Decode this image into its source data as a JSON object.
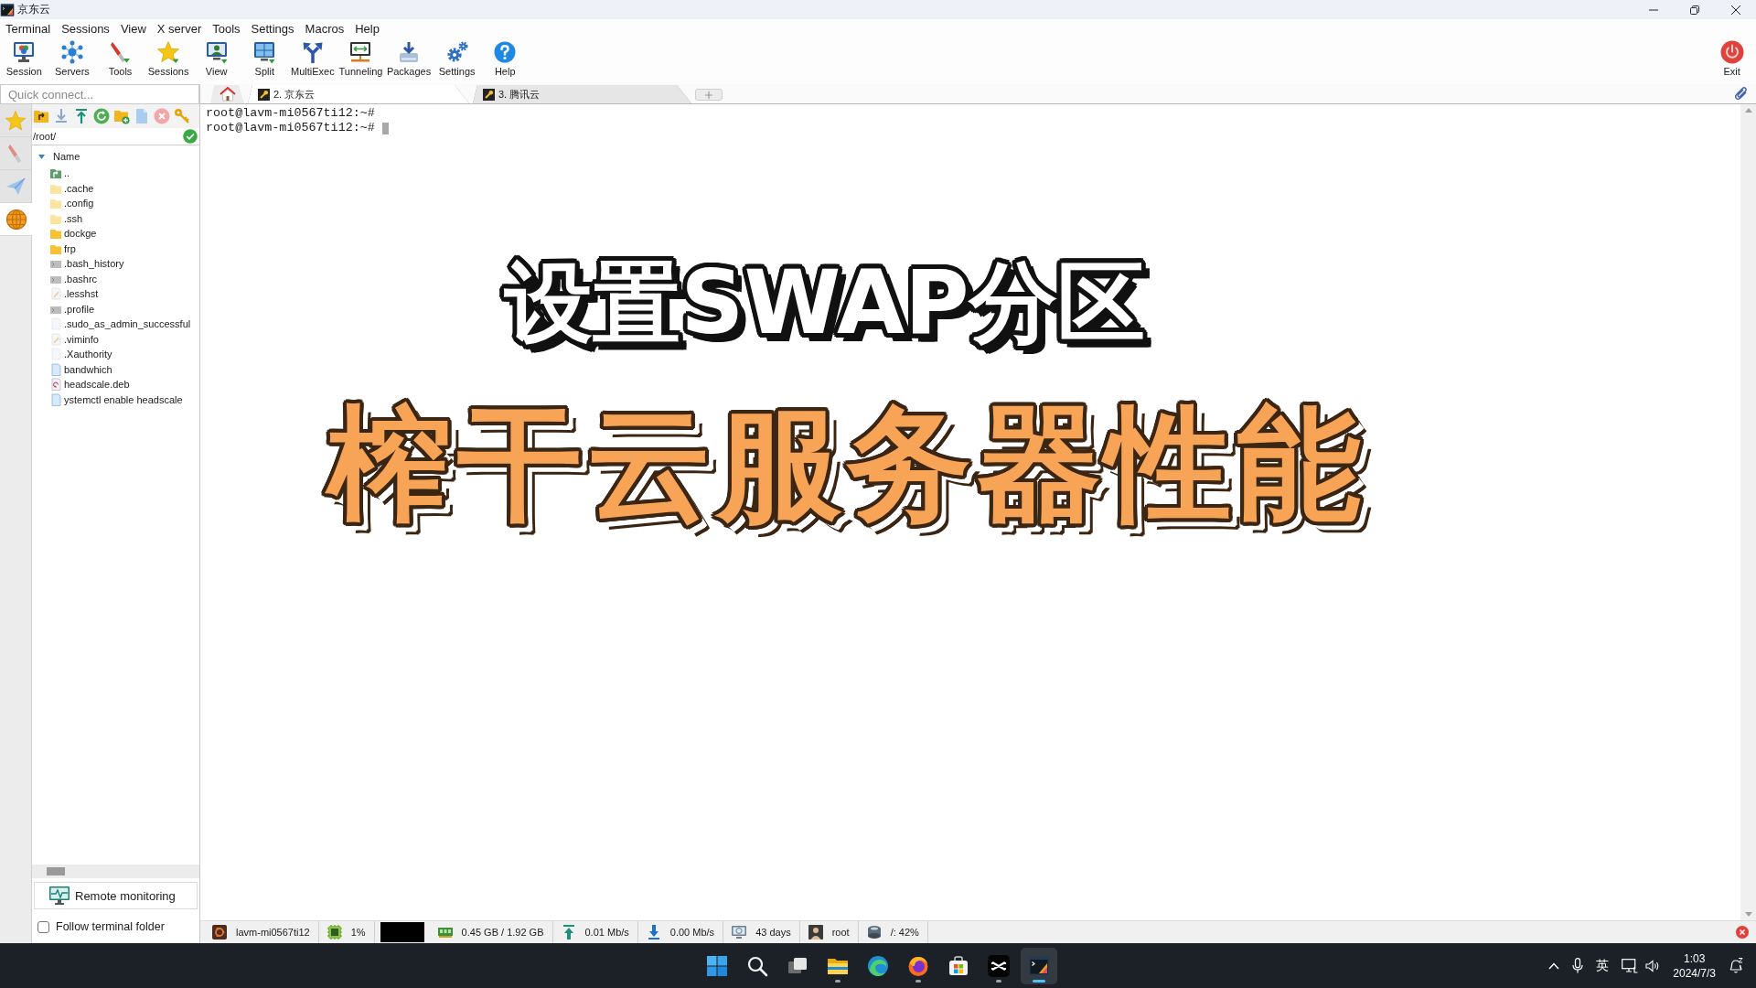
{
  "window": {
    "title": "京东云"
  },
  "menu": [
    "Terminal",
    "Sessions",
    "View",
    "X server",
    "Tools",
    "Settings",
    "Macros",
    "Help"
  ],
  "toolbar": [
    {
      "kind": "session",
      "label": "Session"
    },
    {
      "kind": "servers",
      "label": "Servers"
    },
    {
      "kind": "tools",
      "label": "Tools"
    },
    {
      "kind": "sessions",
      "label": "Sessions"
    },
    {
      "kind": "view",
      "label": "View"
    },
    {
      "kind": "split",
      "label": "Split"
    },
    {
      "kind": "multiexec",
      "label": "MultiExec"
    },
    {
      "kind": "tunneling",
      "label": "Tunneling"
    },
    {
      "kind": "packages",
      "label": "Packages"
    },
    {
      "kind": "settings",
      "label": "Settings"
    },
    {
      "kind": "help",
      "label": "Help"
    }
  ],
  "exit_button": {
    "label": "Exit"
  },
  "quick_connect": {
    "placeholder": "Quick connect..."
  },
  "tabs": [
    {
      "label": "2. 京东云",
      "selected": true
    },
    {
      "label": "3. 腾讯云",
      "selected": false
    }
  ],
  "side_tabs": [
    {
      "kind": "sessions",
      "selected": false
    },
    {
      "kind": "tools",
      "selected": false
    },
    {
      "kind": "macros",
      "selected": false
    },
    {
      "kind": "sftp",
      "selected": true
    }
  ],
  "file_browser": {
    "path": "/root/",
    "columns": [
      "Name"
    ],
    "files": [
      {
        "name": "..",
        "kind": "parent"
      },
      {
        "name": ".cache",
        "kind": "hidden-folder"
      },
      {
        "name": ".config",
        "kind": "hidden-folder"
      },
      {
        "name": ".ssh",
        "kind": "hidden-folder"
      },
      {
        "name": "dockge",
        "kind": "folder"
      },
      {
        "name": "frp",
        "kind": "folder"
      },
      {
        "name": ".bash_history",
        "kind": "shell-file"
      },
      {
        "name": ".bashrc",
        "kind": "shell-file"
      },
      {
        "name": ".lesshst",
        "kind": "edit-file"
      },
      {
        "name": ".profile",
        "kind": "shell-file"
      },
      {
        "name": ".sudo_as_admin_successful",
        "kind": "hidden-file"
      },
      {
        "name": ".viminfo",
        "kind": "edit-file"
      },
      {
        "name": ".Xauthority",
        "kind": "hidden-file"
      },
      {
        "name": "bandwhich",
        "kind": "file"
      },
      {
        "name": "headscale.deb",
        "kind": "deb"
      },
      {
        "name": "ystemctl enable headscale",
        "kind": "file"
      }
    ],
    "remote_monitoring": {
      "label": "Remote monitoring"
    },
    "follow_terminal_folder": {
      "label": "Follow terminal folder",
      "checked": false
    }
  },
  "terminal": {
    "lines": [
      {
        "text": "root@lavm-mi0567ti12:~#",
        "cursor": false
      },
      {
        "text": "root@lavm-mi0567ti12:~#",
        "cursor": true
      }
    ]
  },
  "overlay": {
    "title": "设置SWAP分区",
    "subtitle": "榨干云服务器性能"
  },
  "status_bar": [
    {
      "kind": "host",
      "text": "lavm-mi0567ti12"
    },
    {
      "kind": "cpu",
      "text": "1%"
    },
    {
      "kind": "cpu-graph"
    },
    {
      "kind": "memory",
      "text": "0.45 GB / 1.92 GB"
    },
    {
      "kind": "upload",
      "text": "0.01 Mb/s"
    },
    {
      "kind": "download",
      "text": "0.00 Mb/s"
    },
    {
      "kind": "uptime",
      "text": "43 days"
    },
    {
      "kind": "user",
      "text": "root"
    },
    {
      "kind": "disk",
      "text": "/: 42%"
    }
  ],
  "taskbar": {
    "apps": [
      {
        "kind": "start",
        "running": false,
        "active": false
      },
      {
        "kind": "search",
        "running": false,
        "active": false
      },
      {
        "kind": "task-view",
        "running": false,
        "active": false
      },
      {
        "kind": "explorer",
        "running": true,
        "active": false
      },
      {
        "kind": "edge",
        "running": false,
        "active": false
      },
      {
        "kind": "firefox",
        "running": true,
        "active": false
      },
      {
        "kind": "store",
        "running": false,
        "active": false
      },
      {
        "kind": "capcut",
        "running": true,
        "active": false
      },
      {
        "kind": "mobaxterm",
        "running": true,
        "active": true
      }
    ],
    "tray": {
      "input_method": "英",
      "time": "1:03",
      "date": "2024/7/3"
    }
  }
}
